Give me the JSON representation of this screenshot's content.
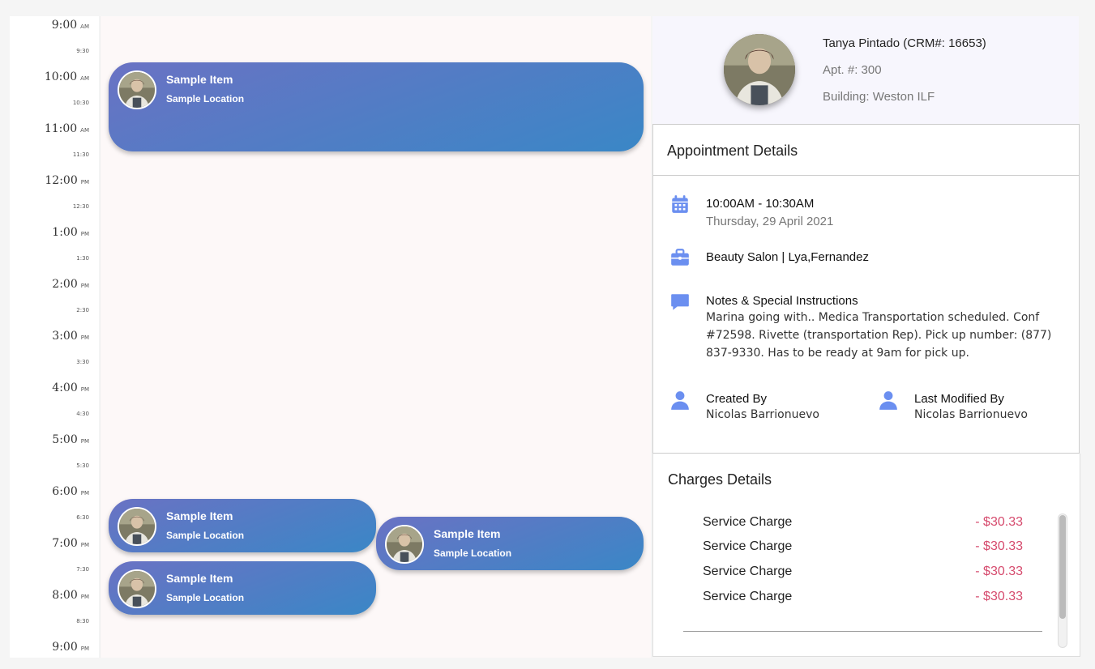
{
  "timeline": {
    "labels": [
      {
        "t": "9:00",
        "ap": "AM",
        "major": true
      },
      {
        "t": "9:30",
        "major": false
      },
      {
        "t": "10:00",
        "ap": "AM",
        "major": true
      },
      {
        "t": "10:30",
        "major": false
      },
      {
        "t": "11:00",
        "ap": "AM",
        "major": true
      },
      {
        "t": "11:30",
        "major": false
      },
      {
        "t": "12:00",
        "ap": "PM",
        "major": true
      },
      {
        "t": "12:30",
        "major": false
      },
      {
        "t": "1:00",
        "ap": "PM",
        "major": true
      },
      {
        "t": "1:30",
        "major": false
      },
      {
        "t": "2:00",
        "ap": "PM",
        "major": true
      },
      {
        "t": "2:30",
        "major": false
      },
      {
        "t": "3:00",
        "ap": "PM",
        "major": true
      },
      {
        "t": "3:30",
        "major": false
      },
      {
        "t": "4:00",
        "ap": "PM",
        "major": true
      },
      {
        "t": "4:30",
        "major": false
      },
      {
        "t": "5:00",
        "ap": "PM",
        "major": true
      },
      {
        "t": "5:30",
        "major": false
      },
      {
        "t": "6:00",
        "ap": "PM",
        "major": true
      },
      {
        "t": "6:30",
        "major": false
      },
      {
        "t": "7:00",
        "ap": "PM",
        "major": true
      },
      {
        "t": "7:30",
        "major": false
      },
      {
        "t": "8:00",
        "ap": "PM",
        "major": true
      },
      {
        "t": "8:30",
        "major": false
      },
      {
        "t": "9:00",
        "ap": "PM",
        "major": true
      }
    ]
  },
  "events": [
    {
      "title": "Sample Item",
      "location": "Sample Location"
    },
    {
      "title": "Sample Item",
      "location": "Sample Location"
    },
    {
      "title": "Sample Item",
      "location": "Sample Location"
    },
    {
      "title": "Sample Item",
      "location": "Sample Location"
    }
  ],
  "profile": {
    "name": "Tanya Pintado (CRM#: 16653)",
    "apt": "Apt. #: 300",
    "building": "Building: Weston ILF"
  },
  "appointment": {
    "header": "Appointment Details",
    "time": "10:00AM - 10:30AM",
    "date": "Thursday, 29 April 2021",
    "service": "Beauty Salon | Lya,Fernandez",
    "notes_label": "Notes & Special Instructions",
    "notes": "Marina going with.. Medica Transportation scheduled. Conf #72598. Rivette (transportation Rep). Pick up number: (877) 837-9330. Has to be ready at 9am for pick up.",
    "created_label": "Created By",
    "created_by": "Nicolas Barrionuevo",
    "modified_label": "Last Modified By",
    "modified_by": "Nicolas Barrionuevo"
  },
  "charges": {
    "title": "Charges Details",
    "items": [
      {
        "label": "Service Charge",
        "amount": "- $30.33"
      },
      {
        "label": "Service Charge",
        "amount": "- $30.33"
      },
      {
        "label": "Service Charge",
        "amount": "- $30.33"
      },
      {
        "label": "Service Charge",
        "amount": "- $30.33"
      }
    ]
  },
  "colors": {
    "event_start": "#6a72c4",
    "event_end": "#3a87c6",
    "icon": "#6b8ff0",
    "charge_amount": "#d64b6e"
  },
  "icons": [
    "calendar-icon",
    "briefcase-icon",
    "chat-bubble-icon",
    "person-icon"
  ]
}
